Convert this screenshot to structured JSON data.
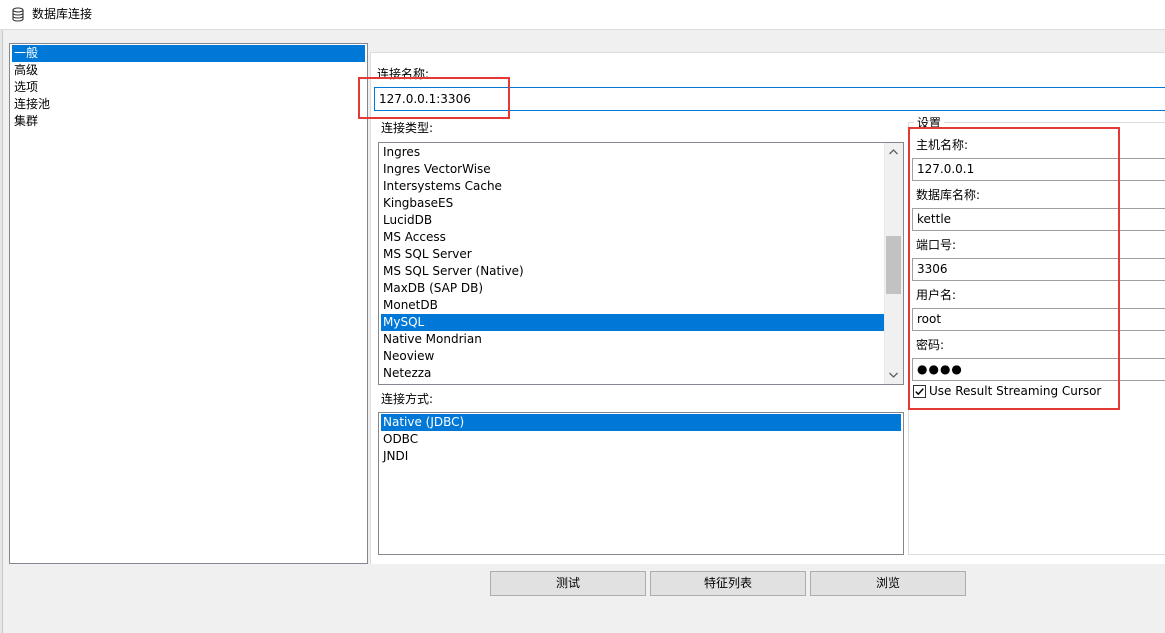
{
  "window": {
    "title": "数据库连接",
    "icon": "database-icon"
  },
  "categories": [
    {
      "label": "一般",
      "selected": true
    },
    {
      "label": "高级",
      "selected": false
    },
    {
      "label": "选项",
      "selected": false
    },
    {
      "label": "连接池",
      "selected": false
    },
    {
      "label": "集群",
      "selected": false
    }
  ],
  "connection_name": {
    "label": "连接名称:",
    "value": "127.0.0.1:3306"
  },
  "connection_type": {
    "label": "连接类型:",
    "items": [
      "Ingres",
      "Ingres VectorWise",
      "Intersystems Cache",
      "KingbaseES",
      "LucidDB",
      "MS Access",
      "MS SQL Server",
      "MS SQL Server (Native)",
      "MaxDB (SAP DB)",
      "MonetDB",
      "MySQL",
      "Native Mondrian",
      "Neoview",
      "Netezza"
    ],
    "selected": "MySQL"
  },
  "access_method": {
    "label": "连接方式:",
    "items": [
      "Native (JDBC)",
      "ODBC",
      "JNDI"
    ],
    "selected": "Native (JDBC)"
  },
  "settings": {
    "title": "设置",
    "host_label": "主机名称:",
    "host_value": "127.0.0.1",
    "db_label": "数据库名称:",
    "db_value": "kettle",
    "port_label": "端口号:",
    "port_value": "3306",
    "user_label": "用户名:",
    "user_value": "root",
    "password_label": "密码:",
    "password_value": "●●●●",
    "cursor_label": "Use Result Streaming Cursor",
    "cursor_checked": true
  },
  "buttons": {
    "test": "测试",
    "features": "特征列表",
    "explore": "浏览"
  },
  "colors": {
    "selection": "#0078d7",
    "annotation": "#e53935"
  }
}
